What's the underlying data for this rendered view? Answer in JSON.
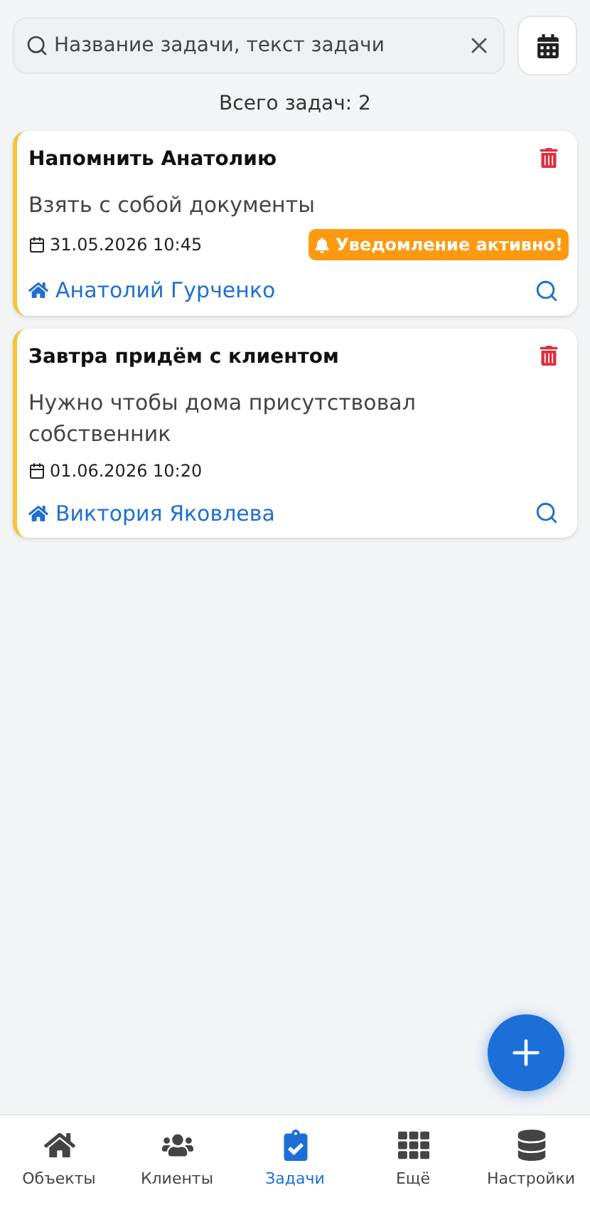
{
  "search": {
    "placeholder": "Название задачи, текст задачи"
  },
  "total": "Всего задач: 2",
  "tasks": [
    {
      "title": "Напомнить Анатолию",
      "text": "Взять с собой документы",
      "date": "31.05.2026 10:45",
      "notification": "Уведомление активно!",
      "client": "Анатолий Гурченко"
    },
    {
      "title": "Завтра придём с клиентом",
      "text": "Нужно чтобы дома присутствовал собственник",
      "date": "01.06.2026 10:20",
      "client": "Виктория Яковлева"
    }
  ],
  "nav": [
    {
      "kind": "objects",
      "label": "Объекты",
      "selected": false
    },
    {
      "kind": "clients",
      "label": "Клиенты",
      "selected": false
    },
    {
      "kind": "tasks",
      "label": "Задачи",
      "selected": true
    },
    {
      "kind": "more",
      "label": "Ещё",
      "selected": false
    },
    {
      "kind": "settings",
      "label": "Настройки",
      "selected": false
    }
  ]
}
